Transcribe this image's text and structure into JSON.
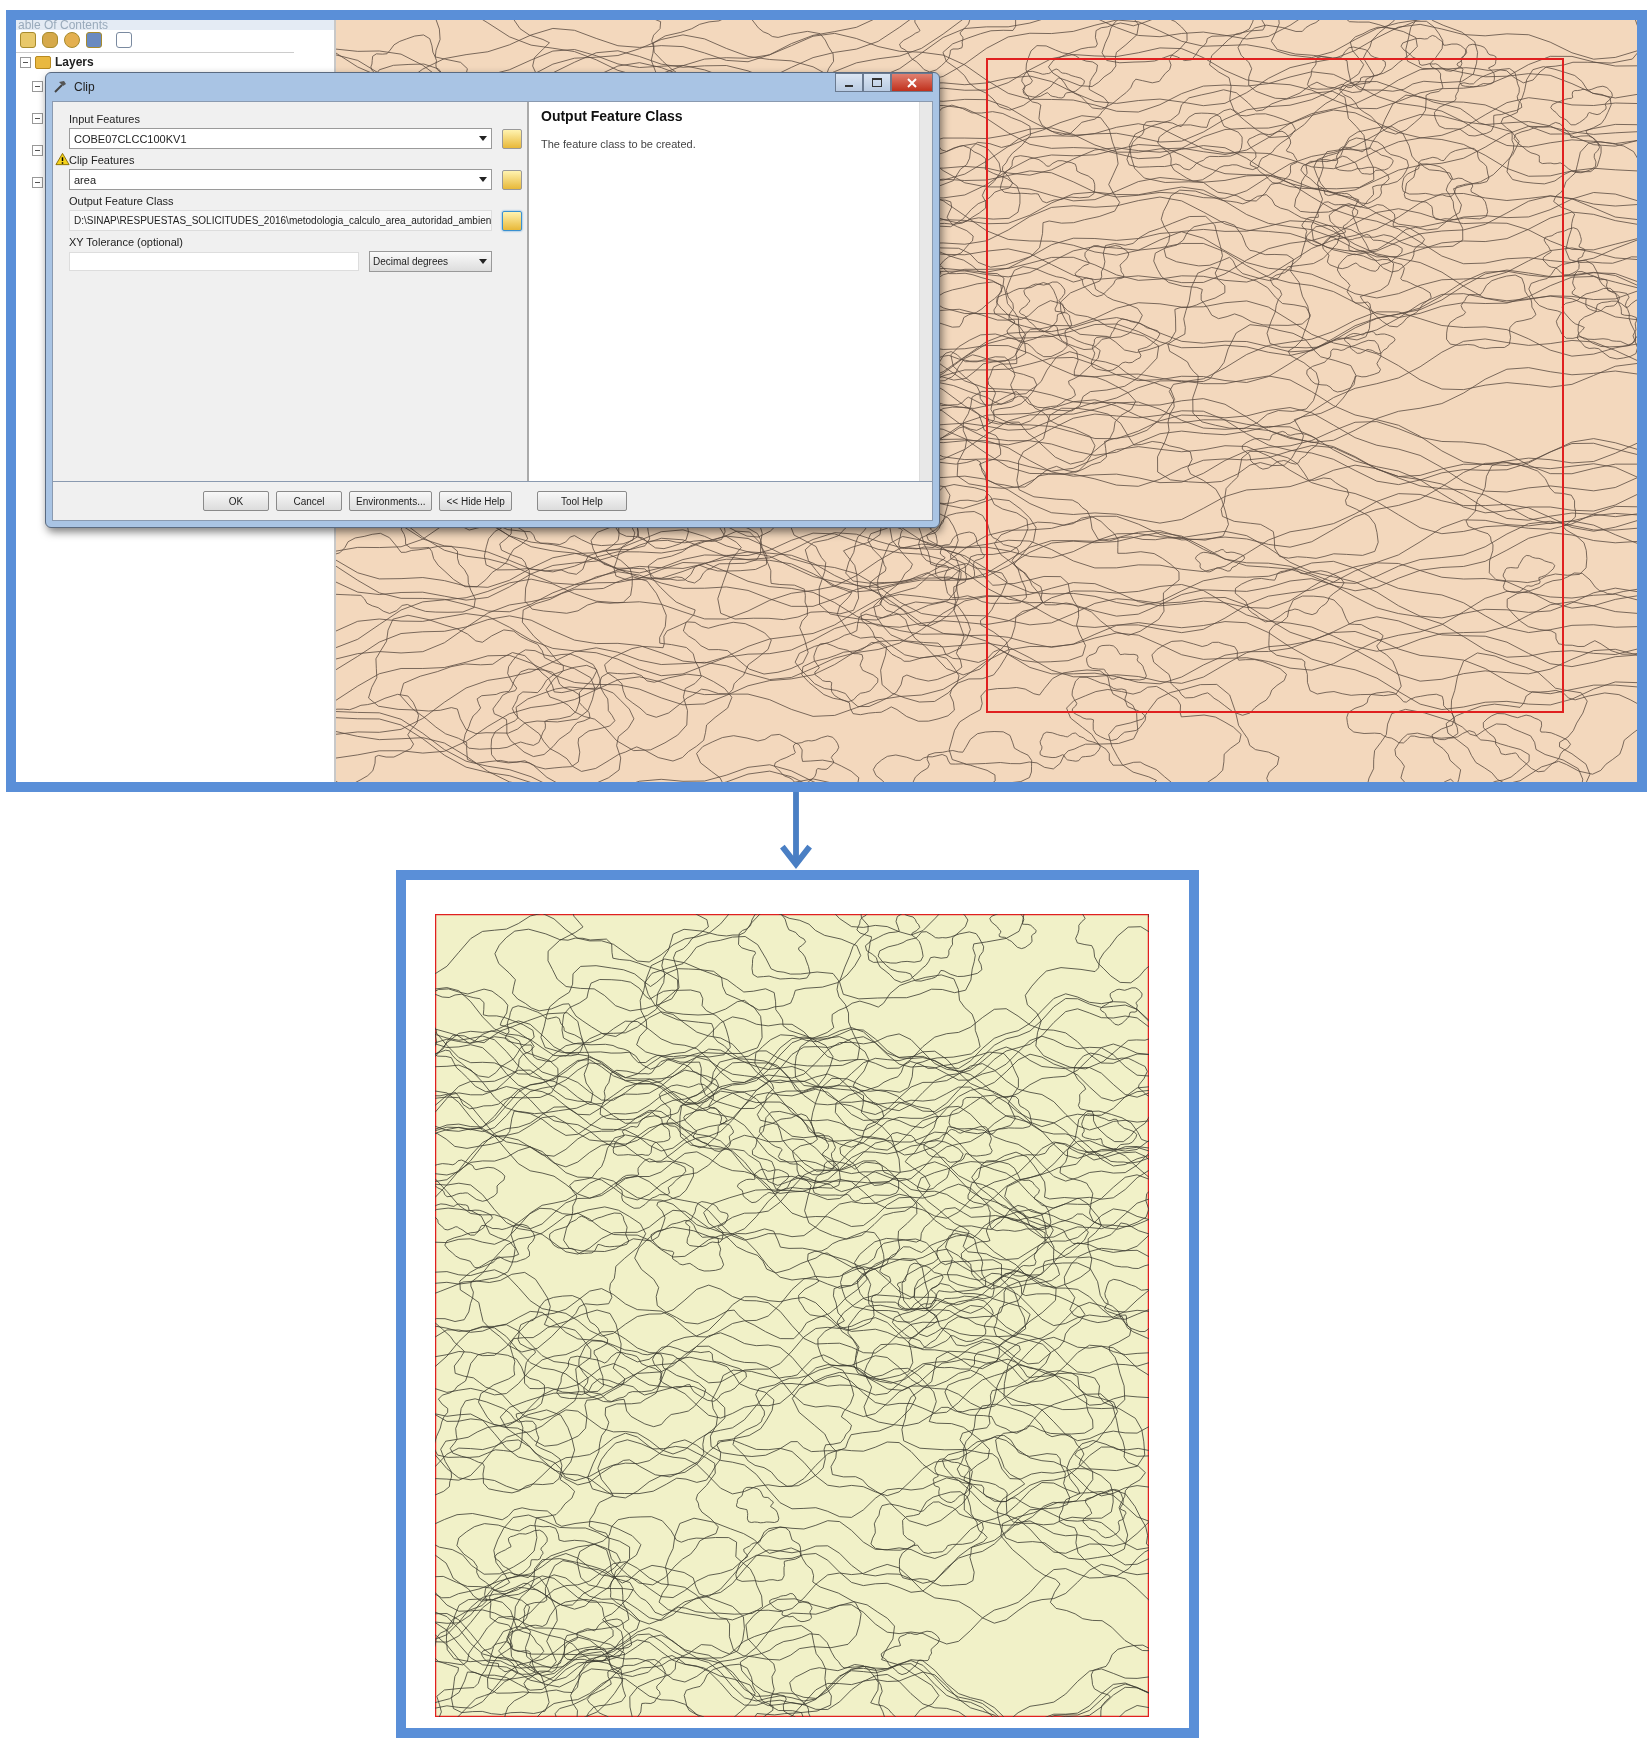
{
  "toc": {
    "title": "able Of Contents",
    "root": {
      "label": "Layers",
      "expanded": true
    }
  },
  "dialog": {
    "title": "Clip",
    "parameters": [
      {
        "kind": "combo",
        "label": "Input Features",
        "value": "COBE07CLCC100KV1",
        "warning": false
      },
      {
        "kind": "combo",
        "label": "Clip Features",
        "value": "area",
        "warning": true
      },
      {
        "kind": "path",
        "label": "Output Feature Class",
        "value": "D:\\SINAP\\RESPUESTAS_SOLICITUDES_2016\\metodologia_calculo_area_autoridad_ambien",
        "warning": false
      },
      {
        "kind": "tolerance",
        "label": "XY Tolerance (optional)",
        "unit": "Decimal degrees",
        "warning": false
      }
    ],
    "help": {
      "title": "Output Feature Class",
      "text": "The feature class to be created."
    },
    "buttons": [
      "OK",
      "Cancel",
      "Environments...",
      "<< Hide Help",
      "Tool Help"
    ]
  }
}
